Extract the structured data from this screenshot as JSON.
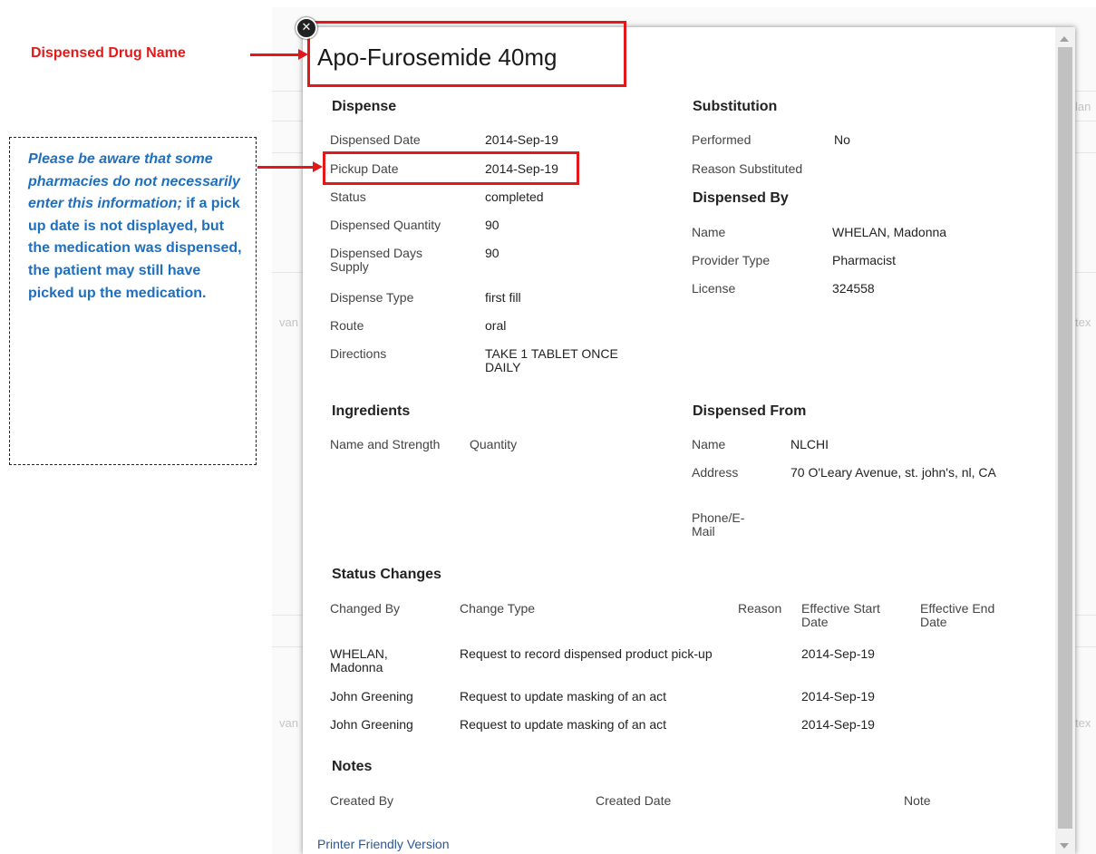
{
  "annotations": {
    "drug_name_label": "Dispensed Drug Name",
    "note_italic": "Please be aware that some pharmacies do not necessarily enter this information;",
    "note_rest": "if a pick up date is not displayed, but the medication was dispensed, the patient may still have picked up the medication."
  },
  "background": {
    "frag1": "van",
    "frag2": "van",
    "frag3": "tex",
    "frag4": "tex",
    "frag5": "lan"
  },
  "modal": {
    "close_glyph": "✕",
    "drug_name": "Apo-Furosemide 40mg",
    "dispense": {
      "heading": "Dispense",
      "rows": [
        {
          "label": "Dispensed Date",
          "value": "2014-Sep-19"
        },
        {
          "label": "Pickup Date",
          "value": "2014-Sep-19"
        },
        {
          "label": "Status",
          "value": "completed"
        },
        {
          "label": "Dispensed Quantity",
          "value": "90"
        },
        {
          "label": "Dispensed Days Supply",
          "value": "90"
        },
        {
          "label": "Dispense Type",
          "value": "first fill"
        },
        {
          "label": "Route",
          "value": "oral"
        },
        {
          "label": "Directions",
          "value": "TAKE 1 TABLET ONCE DAILY"
        }
      ]
    },
    "substitution": {
      "heading": "Substitution",
      "rows": [
        {
          "label": "Performed",
          "value": "No"
        },
        {
          "label": "Reason Substituted",
          "value": ""
        }
      ]
    },
    "dispensed_by": {
      "heading": "Dispensed By",
      "rows": [
        {
          "label": "Name",
          "value": "WHELAN, Madonna"
        },
        {
          "label": "Provider Type",
          "value": "Pharmacist"
        },
        {
          "label": "License",
          "value": "324558"
        }
      ]
    },
    "ingredients": {
      "heading": "Ingredients",
      "col1": "Name and Strength",
      "col2": "Quantity"
    },
    "dispensed_from": {
      "heading": "Dispensed From",
      "rows": [
        {
          "label": "Name",
          "value": "NLCHI"
        },
        {
          "label": "Address",
          "value": "70 O'Leary Avenue, st. john's, nl, CA"
        },
        {
          "label": "Phone/E-Mail",
          "value": ""
        }
      ]
    },
    "status_changes": {
      "heading": "Status Changes",
      "columns": [
        "Changed By",
        "Change Type",
        "Reason",
        "Effective Start Date",
        "Effective End Date"
      ],
      "rows": [
        {
          "by": "WHELAN, Madonna",
          "type": "Request to record dispensed product pick-up",
          "reason": "",
          "start": "2014-Sep-19",
          "end": ""
        },
        {
          "by": "John Greening",
          "type": "Request to update masking of an act",
          "reason": "",
          "start": "2014-Sep-19",
          "end": ""
        },
        {
          "by": "John Greening",
          "type": "Request to update masking of an act",
          "reason": "",
          "start": "2014-Sep-19",
          "end": ""
        }
      ]
    },
    "notes": {
      "heading": "Notes",
      "columns": [
        "Created By",
        "Created Date",
        "Note"
      ]
    },
    "printer_link": "Printer Friendly Version"
  },
  "colors": {
    "annotation_red": "#e31919",
    "annotation_blue": "#1f6fbf",
    "link_blue": "#2b5797"
  }
}
